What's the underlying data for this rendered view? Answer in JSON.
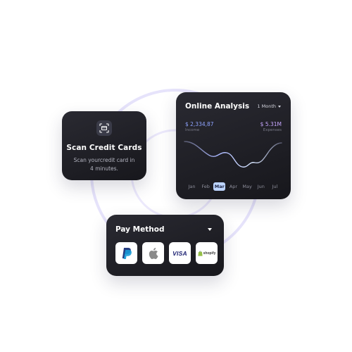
{
  "scan_card": {
    "title": "Scan Credit Cards",
    "description_line1": "Scan yourcredit card in",
    "description_line2": "4 minutes.",
    "icon": "card-scan-icon"
  },
  "analysis_card": {
    "title": "Online Analysis",
    "period": "1 Month",
    "income_value": "$ 2,334,87",
    "income_label": "Income",
    "expenses_value": "$ 5.31M",
    "expenses_label": "Expenses",
    "months": [
      "Jan",
      "Feb",
      "Mar",
      "Apr",
      "May",
      "Jun",
      "Jul"
    ],
    "active_month": "Mar",
    "colors": {
      "income": "#8fa3ff",
      "expenses": "#c7a7ff",
      "active_month_bg": "#bcd4ff",
      "line_start": "#aab7ff",
      "line_end": "#d8e6ff"
    }
  },
  "pay_card": {
    "title": "Pay Method",
    "methods": [
      {
        "name": "PayPal",
        "icon": "paypal-icon"
      },
      {
        "name": "Apple Pay",
        "icon": "apple-icon"
      },
      {
        "name": "VISA",
        "icon": "visa-icon"
      },
      {
        "name": "shopify",
        "icon": "shopify-icon"
      }
    ]
  },
  "background": {
    "ring_color": "#e4e1fb"
  }
}
